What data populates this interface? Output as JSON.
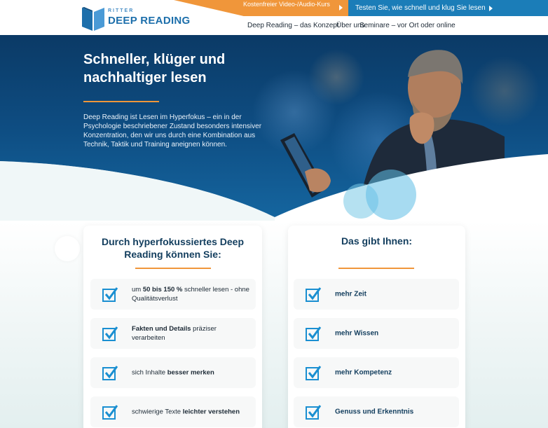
{
  "header": {
    "logo_small": "RITTER",
    "logo_big": "DEEP READING",
    "cta_orange": "Kostenfreier Video-/Audio-Kurs",
    "cta_blue": "Testen Sie, wie schnell und klug Sie lesen",
    "nav": [
      "Deep Reading – das Konzept",
      "Über uns",
      "Seminare – vor Ort oder online"
    ]
  },
  "hero": {
    "title": "Schneller, klüger und nachhaltiger lesen",
    "text": "Deep Reading ist Lesen im Hyperfokus – ein in der Psychologie beschriebener Zustand besonders intensiver Konzentration, den wir uns durch eine Kombination aus Technik, Taktik und Training aneignen können."
  },
  "left_card": {
    "title": "Durch hyperfokussiertes Deep Reading können Sie:",
    "items": [
      {
        "pre": "um ",
        "bold": "50 bis 150 %",
        "post": " schneller lesen - ohne Qualitätsverlust"
      },
      {
        "pre": "",
        "bold": "Fakten und Details",
        "post": " präziser verarbeiten"
      },
      {
        "pre": "sich Inhalte ",
        "bold": "besser merken",
        "post": ""
      },
      {
        "pre": "schwierige Texte ",
        "bold": "leichter verstehen",
        "post": ""
      }
    ]
  },
  "right_card": {
    "title": "Das gibt Ihnen:",
    "items": [
      "mehr Zeit",
      "mehr Wissen",
      "mehr Kompetenz",
      "Genuss und Erkenntnis"
    ]
  },
  "colors": {
    "accent_orange": "#f0963a",
    "brand_blue": "#1b7db8",
    "check_blue": "#1a8fd1",
    "dark_navy": "#133e5e"
  }
}
